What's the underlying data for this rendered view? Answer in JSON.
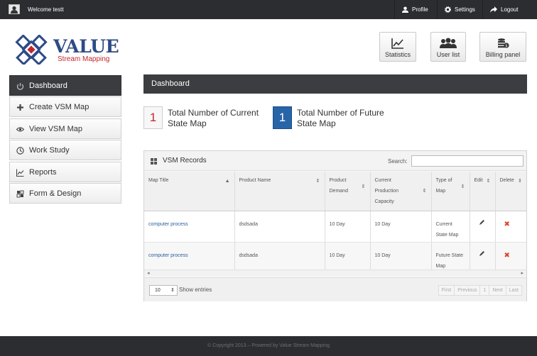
{
  "topbar": {
    "welcome": "Welcome testt",
    "profile": "Profile",
    "settings": "Settings",
    "logout": "Logout"
  },
  "logo": {
    "brand": "VALUE",
    "subtitle": "Stream Mapping"
  },
  "header_buttons": {
    "statistics": "Statistics",
    "user_list": "User list",
    "billing": "Billing panel"
  },
  "sidebar": {
    "items": [
      {
        "label": "Dashboard",
        "icon": "power-icon",
        "active": true
      },
      {
        "label": "Create VSM Map",
        "icon": "plus-icon"
      },
      {
        "label": "View VSM Map",
        "icon": "eye-icon"
      },
      {
        "label": "Work Study",
        "icon": "clock-icon"
      },
      {
        "label": "Reports",
        "icon": "chart-icon"
      },
      {
        "label": "Form & Design",
        "icon": "grid-icon"
      }
    ]
  },
  "main": {
    "title": "Dashboard",
    "stats": [
      {
        "value": "1",
        "label": "Total Number of Current State Map",
        "color": "#c0272d"
      },
      {
        "value": "1",
        "label": "Total Number of Future State Map",
        "color": "#2764a8"
      }
    ]
  },
  "records": {
    "title": "VSM Records",
    "search_label": "Search:",
    "search_value": "",
    "columns": [
      "Map Title",
      "Product Name",
      "Product Demand",
      "Current Production Capacity",
      "Type of Map",
      "Edit",
      "Delete"
    ],
    "rows": [
      {
        "map_title": "computer process",
        "product_name": "dsdsada",
        "demand": "10 Day",
        "capacity": "10 Day",
        "type": "Current State Map"
      },
      {
        "map_title": "computer process",
        "product_name": "dsdsada",
        "demand": "10 Day",
        "capacity": "10 Day",
        "type": "Future State Map"
      }
    ],
    "page_size": "10",
    "show_entries": "Show entries",
    "pager": {
      "first": "First",
      "previous": "Previous",
      "page": "1",
      "next": "Next",
      "last": "Last"
    }
  },
  "footer": {
    "text": "© Copyright 2013 – Powered by Value Stream Mapping"
  }
}
